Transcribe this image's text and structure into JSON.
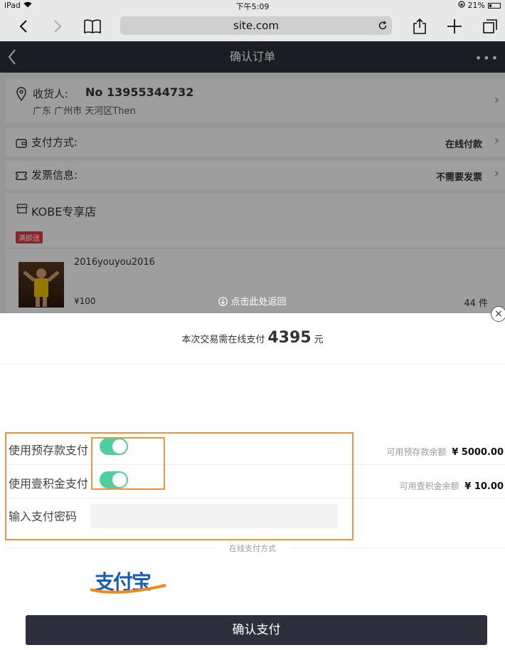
{
  "status_bar": {
    "device": "iPad",
    "time": "下午5:09",
    "battery": "21%"
  },
  "browser": {
    "url": "site.com"
  },
  "order_page": {
    "title": "确认订单",
    "receiver_label": "收货人:",
    "receiver_phone": "No 13955344732",
    "receiver_address": "广东 广州市 天河区Then",
    "payment_method_label": "支付方式:",
    "payment_method_value": "在线付款",
    "invoice_label": "发票信息:",
    "invoice_value": "不需要发票",
    "store_name": "KOBE专享店",
    "promo_badge": "满即送",
    "product_name": "2016youyou2016",
    "product_price": "¥100",
    "product_qty": "44 件",
    "return_text": "点击此处返回"
  },
  "payment_sheet": {
    "amount_prefix": "本次交易需在线支付",
    "amount": "4395",
    "amount_unit": "元",
    "prepaid_label": "使用预存款支付",
    "prepaid_balance_label": "可用预存款余额",
    "prepaid_balance_value": "¥ 5000.00",
    "prepaid_enabled": true,
    "points_label": "使用壹积金支付",
    "points_balance_label": "可用壹积金余额",
    "points_balance_value": "¥ 10.00",
    "points_enabled": true,
    "password_label": "输入支付密码",
    "password_placeholder": "",
    "online_label": "在线支付方式",
    "alipay_text": "支付宝",
    "confirm_button": "确认支付"
  },
  "colors": {
    "toggle_on": "#4dce9c",
    "highlight": "#f0943e",
    "nav_bg": "#2d2f3d"
  }
}
